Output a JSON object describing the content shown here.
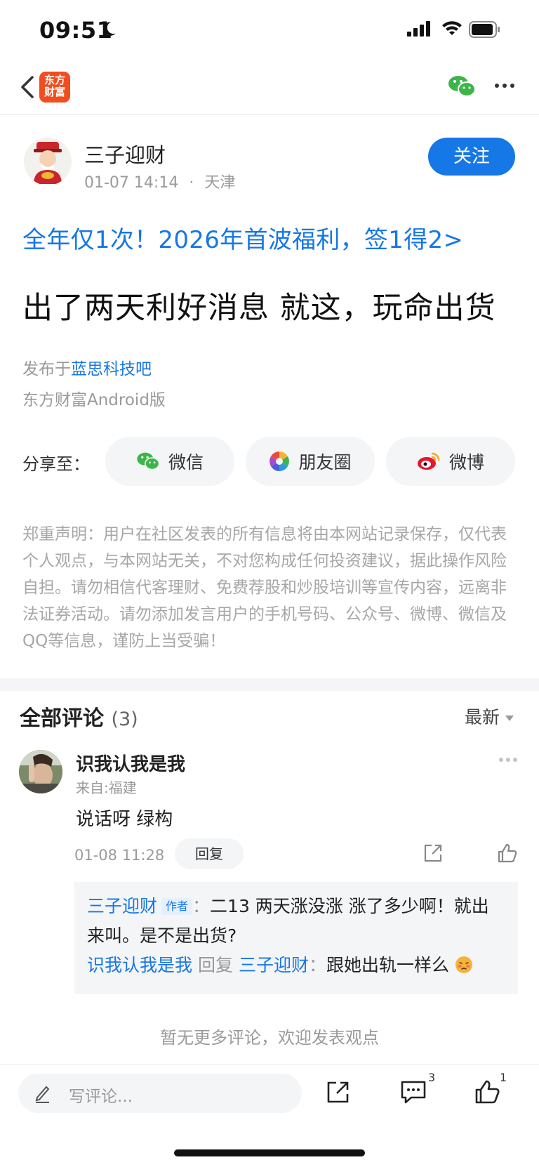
{
  "status_bar": {
    "time": "09:51"
  },
  "nav": {
    "logo_line1": "东方",
    "logo_line2": "财富"
  },
  "author": {
    "name": "三子迎财",
    "datetime": "01-07 14:14",
    "location": "天津",
    "follow_label": "关注"
  },
  "promo_link": "全年仅1次！2026年首波福利，签1得2>",
  "post_title": "出了两天利好消息 就这，玩命出货",
  "published": {
    "prefix": "发布于",
    "forum": "蓝思科技吧",
    "client": "东方财富Android版"
  },
  "share": {
    "label": "分享至：",
    "options": [
      {
        "label": "微信",
        "icon": "wechat-icon"
      },
      {
        "label": "朋友圈",
        "icon": "moments-icon"
      },
      {
        "label": "微博",
        "icon": "weibo-icon"
      }
    ]
  },
  "disclaimer": "郑重声明：用户在社区发表的所有信息将由本网站记录保存，仅代表个人观点，与本网站无关，不对您构成任何投资建议，据此操作风险自担。请勿相信代客理财、免费荐股和炒股培训等宣传内容，远离非法证券活动。请勿添加发言用户的手机号码、公众号、微博、微信及QQ等信息，谨防上当受骗！",
  "comments": {
    "title": "全部评论",
    "count": "(3)",
    "sort": "最新",
    "items": [
      {
        "user": "识我认我是我",
        "from": "来自:福建",
        "text": "说话呀 绿构",
        "time": "01-08 11:28",
        "reply_label": "回复",
        "replies": [
          {
            "user": "三子迎财",
            "tag": "作者",
            "sep": "：",
            "text": "二13 两天涨没涨 涨了多少啊！就出来叫。是不是出货?"
          },
          {
            "user": "识我认我是我",
            "verb": "回复",
            "target": "三子迎财",
            "sep": "：",
            "text": "跟她出轨一样么"
          }
        ]
      }
    ],
    "no_more": "暂无更多评论，欢迎发表观点"
  },
  "bottom_bar": {
    "input_placeholder": "写评论...",
    "comment_count": "3",
    "like_count": "1"
  },
  "colors": {
    "accent": "#1677e6",
    "brand": "#f04e1f"
  }
}
